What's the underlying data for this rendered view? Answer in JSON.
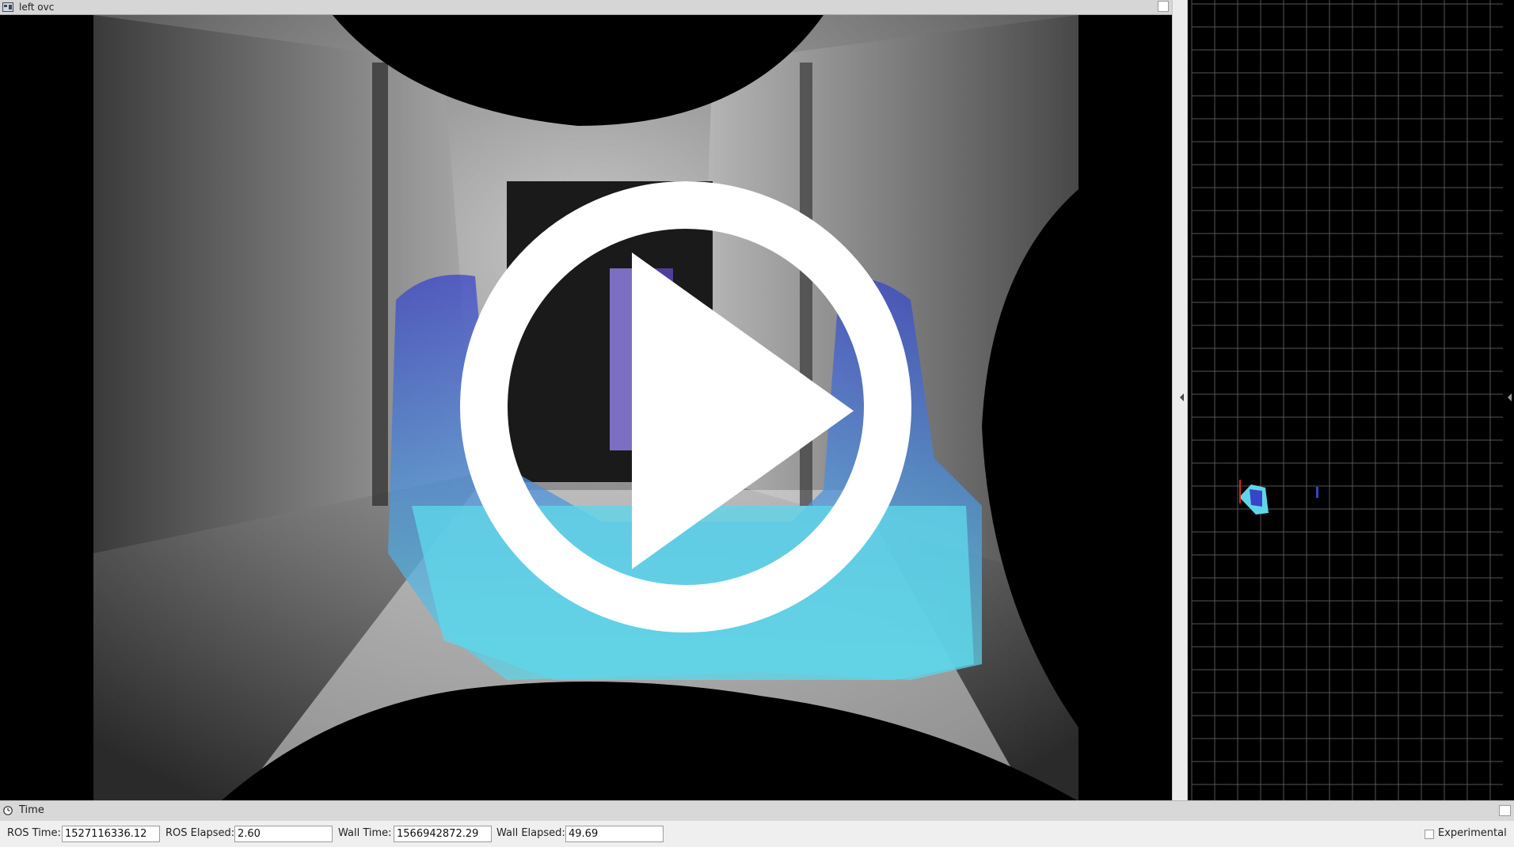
{
  "camera_panel": {
    "title": "left ovc",
    "play_overlay_icon": "play-icon"
  },
  "time_panel": {
    "title": "Time",
    "ros_time_label": "ROS Time:",
    "ros_time_value": "1527116336.12",
    "ros_elapsed_label": "ROS Elapsed:",
    "ros_elapsed_value": "2.60",
    "wall_time_label": "Wall Time:",
    "wall_time_value": "1566942872.29",
    "wall_elapsed_label": "Wall Elapsed:",
    "wall_elapsed_value": "49.69",
    "experimental_label": "Experimental",
    "experimental_checked": false
  },
  "colors": {
    "point_cloud_cyan": "#5fd6e8",
    "point_cloud_blue": "#3a44c8",
    "grid_line": "#555555",
    "axis_red": "#e02020"
  }
}
